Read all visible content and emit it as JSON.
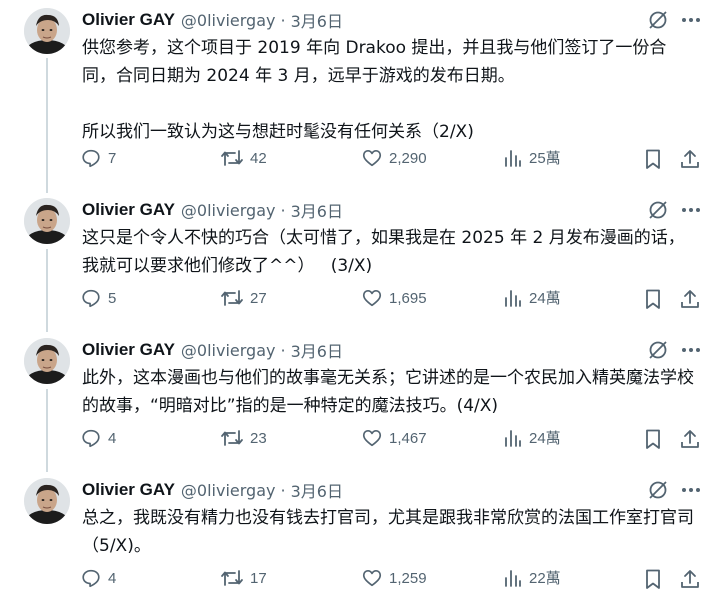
{
  "tweets": [
    {
      "author": "Olivier GAY",
      "handle": "@0liviergay",
      "separator": "·",
      "date": "3月6日",
      "text": "供您参考，这个项目于 2019 年向 Drakoo 提出，并且我与他们签订了一份合同，合同日期为 2024 年 3 月，远早于游戏的发布日期。\n\n所以我们一致认为这与想赶时髦没有任何关系（2/X)",
      "replies": "7",
      "retweets": "42",
      "likes": "2,290",
      "views": "25萬"
    },
    {
      "author": "Olivier GAY",
      "handle": "@0liviergay",
      "separator": "·",
      "date": "3月6日",
      "text": "这只是个令人不快的巧合（太可惜了，如果我是在 2025 年 2 月发布漫画的话，我就可以要求他们修改了^^）   (3/X)",
      "replies": "5",
      "retweets": "27",
      "likes": "1,695",
      "views": "24萬"
    },
    {
      "author": "Olivier GAY",
      "handle": "@0liviergay",
      "separator": "·",
      "date": "3月6日",
      "text": "此外，这本漫画也与他们的故事毫无关系；它讲述的是一个农民加入精英魔法学校的故事，“明暗对比”指的是一种特定的魔法技巧。(4/X)",
      "replies": "4",
      "retweets": "23",
      "likes": "1,467",
      "views": "24萬"
    },
    {
      "author": "Olivier GAY",
      "handle": "@0liviergay",
      "separator": "·",
      "date": "3月6日",
      "text": "总之，我既没有精力也没有钱去打官司，尤其是跟我非常欣赏的法国工作室打官司（5/X)。",
      "replies": "4",
      "retweets": "17",
      "likes": "1,259",
      "views": "22萬"
    }
  ],
  "icons": {
    "avatar": "avatar",
    "grok": "grok-icon",
    "more": "more-icon",
    "reply": "reply-icon",
    "retweet": "retweet-icon",
    "like": "like-icon",
    "views": "views-icon",
    "bookmark": "bookmark-icon",
    "share": "share-icon"
  },
  "colors": {
    "text": "#0f1419",
    "secondary": "#536471",
    "thread_line": "#cfd9de",
    "background": "#ffffff"
  }
}
